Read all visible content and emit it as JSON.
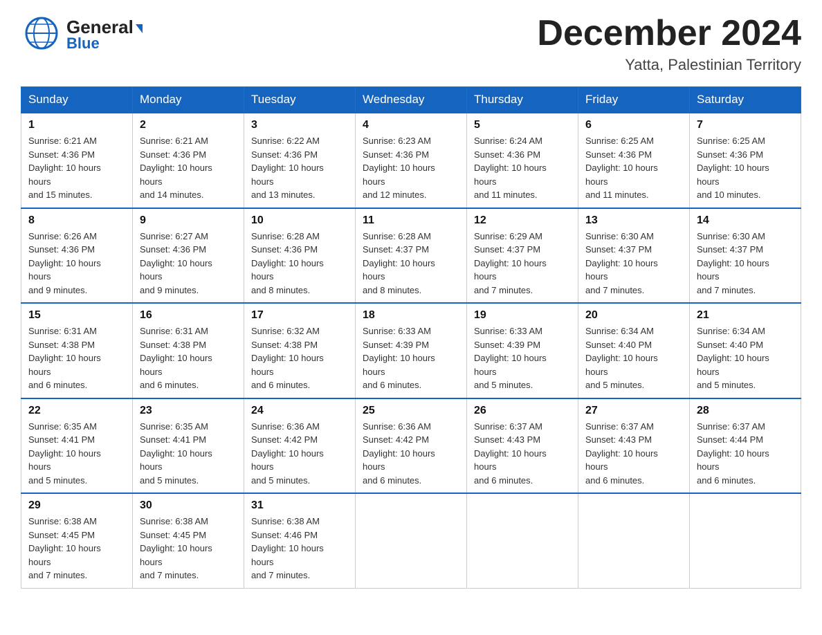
{
  "header": {
    "logo": {
      "general": "General",
      "blue": "Blue",
      "alt": "GeneralBlue logo"
    },
    "title": "December 2024",
    "location": "Yatta, Palestinian Territory"
  },
  "calendar": {
    "days_of_week": [
      "Sunday",
      "Monday",
      "Tuesday",
      "Wednesday",
      "Thursday",
      "Friday",
      "Saturday"
    ],
    "weeks": [
      [
        {
          "day": "1",
          "sunrise": "6:21 AM",
          "sunset": "4:36 PM",
          "daylight": "10 hours and 15 minutes."
        },
        {
          "day": "2",
          "sunrise": "6:21 AM",
          "sunset": "4:36 PM",
          "daylight": "10 hours and 14 minutes."
        },
        {
          "day": "3",
          "sunrise": "6:22 AM",
          "sunset": "4:36 PM",
          "daylight": "10 hours and 13 minutes."
        },
        {
          "day": "4",
          "sunrise": "6:23 AM",
          "sunset": "4:36 PM",
          "daylight": "10 hours and 12 minutes."
        },
        {
          "day": "5",
          "sunrise": "6:24 AM",
          "sunset": "4:36 PM",
          "daylight": "10 hours and 11 minutes."
        },
        {
          "day": "6",
          "sunrise": "6:25 AM",
          "sunset": "4:36 PM",
          "daylight": "10 hours and 11 minutes."
        },
        {
          "day": "7",
          "sunrise": "6:25 AM",
          "sunset": "4:36 PM",
          "daylight": "10 hours and 10 minutes."
        }
      ],
      [
        {
          "day": "8",
          "sunrise": "6:26 AM",
          "sunset": "4:36 PM",
          "daylight": "10 hours and 9 minutes."
        },
        {
          "day": "9",
          "sunrise": "6:27 AM",
          "sunset": "4:36 PM",
          "daylight": "10 hours and 9 minutes."
        },
        {
          "day": "10",
          "sunrise": "6:28 AM",
          "sunset": "4:36 PM",
          "daylight": "10 hours and 8 minutes."
        },
        {
          "day": "11",
          "sunrise": "6:28 AM",
          "sunset": "4:37 PM",
          "daylight": "10 hours and 8 minutes."
        },
        {
          "day": "12",
          "sunrise": "6:29 AM",
          "sunset": "4:37 PM",
          "daylight": "10 hours and 7 minutes."
        },
        {
          "day": "13",
          "sunrise": "6:30 AM",
          "sunset": "4:37 PM",
          "daylight": "10 hours and 7 minutes."
        },
        {
          "day": "14",
          "sunrise": "6:30 AM",
          "sunset": "4:37 PM",
          "daylight": "10 hours and 7 minutes."
        }
      ],
      [
        {
          "day": "15",
          "sunrise": "6:31 AM",
          "sunset": "4:38 PM",
          "daylight": "10 hours and 6 minutes."
        },
        {
          "day": "16",
          "sunrise": "6:31 AM",
          "sunset": "4:38 PM",
          "daylight": "10 hours and 6 minutes."
        },
        {
          "day": "17",
          "sunrise": "6:32 AM",
          "sunset": "4:38 PM",
          "daylight": "10 hours and 6 minutes."
        },
        {
          "day": "18",
          "sunrise": "6:33 AM",
          "sunset": "4:39 PM",
          "daylight": "10 hours and 6 minutes."
        },
        {
          "day": "19",
          "sunrise": "6:33 AM",
          "sunset": "4:39 PM",
          "daylight": "10 hours and 5 minutes."
        },
        {
          "day": "20",
          "sunrise": "6:34 AM",
          "sunset": "4:40 PM",
          "daylight": "10 hours and 5 minutes."
        },
        {
          "day": "21",
          "sunrise": "6:34 AM",
          "sunset": "4:40 PM",
          "daylight": "10 hours and 5 minutes."
        }
      ],
      [
        {
          "day": "22",
          "sunrise": "6:35 AM",
          "sunset": "4:41 PM",
          "daylight": "10 hours and 5 minutes."
        },
        {
          "day": "23",
          "sunrise": "6:35 AM",
          "sunset": "4:41 PM",
          "daylight": "10 hours and 5 minutes."
        },
        {
          "day": "24",
          "sunrise": "6:36 AM",
          "sunset": "4:42 PM",
          "daylight": "10 hours and 5 minutes."
        },
        {
          "day": "25",
          "sunrise": "6:36 AM",
          "sunset": "4:42 PM",
          "daylight": "10 hours and 6 minutes."
        },
        {
          "day": "26",
          "sunrise": "6:37 AM",
          "sunset": "4:43 PM",
          "daylight": "10 hours and 6 minutes."
        },
        {
          "day": "27",
          "sunrise": "6:37 AM",
          "sunset": "4:43 PM",
          "daylight": "10 hours and 6 minutes."
        },
        {
          "day": "28",
          "sunrise": "6:37 AM",
          "sunset": "4:44 PM",
          "daylight": "10 hours and 6 minutes."
        }
      ],
      [
        {
          "day": "29",
          "sunrise": "6:38 AM",
          "sunset": "4:45 PM",
          "daylight": "10 hours and 7 minutes."
        },
        {
          "day": "30",
          "sunrise": "6:38 AM",
          "sunset": "4:45 PM",
          "daylight": "10 hours and 7 minutes."
        },
        {
          "day": "31",
          "sunrise": "6:38 AM",
          "sunset": "4:46 PM",
          "daylight": "10 hours and 7 minutes."
        },
        null,
        null,
        null,
        null
      ]
    ],
    "labels": {
      "sunrise": "Sunrise:",
      "sunset": "Sunset:",
      "daylight": "Daylight:"
    }
  }
}
